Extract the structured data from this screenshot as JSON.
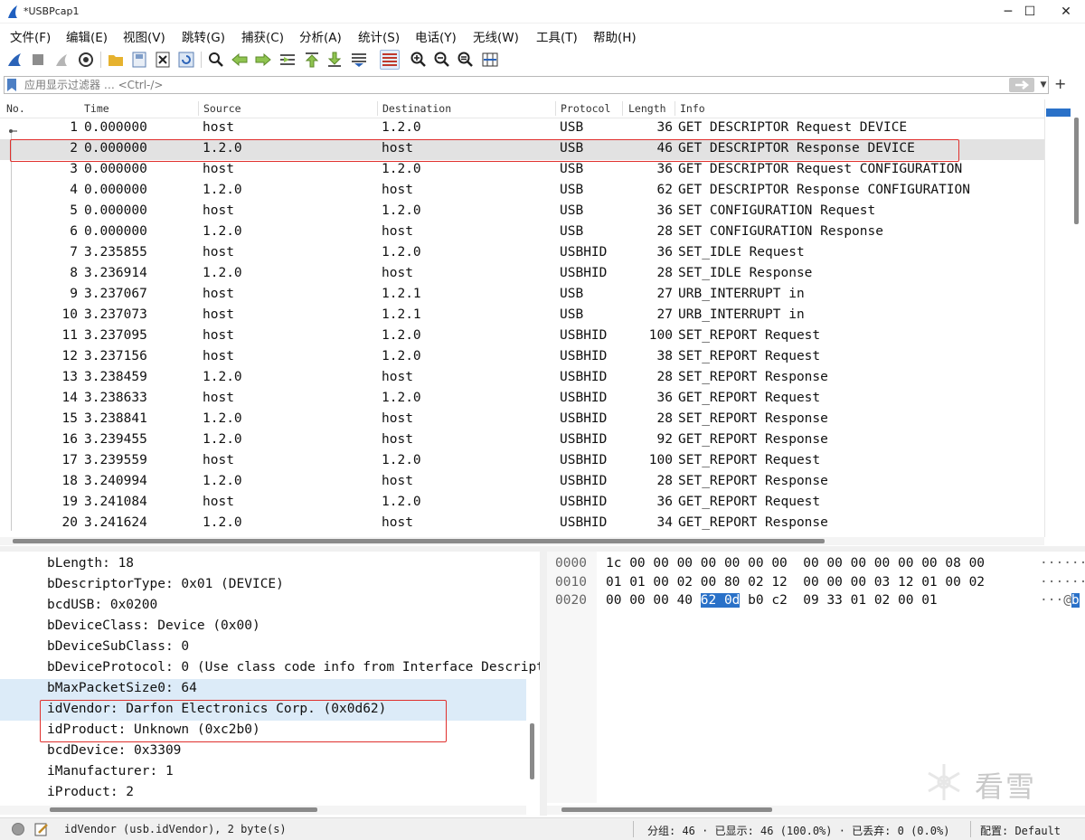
{
  "window": {
    "title": "*USBPcap1",
    "minimize": "─",
    "maximize": "☐",
    "close": "✕"
  },
  "menu": [
    "文件(F)",
    "编辑(E)",
    "视图(V)",
    "跳转(G)",
    "捕获(C)",
    "分析(A)",
    "统计(S)",
    "电话(Y)",
    "无线(W)",
    "工具(T)",
    "帮助(H)"
  ],
  "toolbar": {
    "icons": [
      "shark-fin-start-icon",
      "stop-capture-icon",
      "restart-capture-icon",
      "capture-options-icon",
      "open-folder-icon",
      "save-file-icon",
      "close-file-icon",
      "reload-icon",
      "find-packet-icon",
      "go-back-icon",
      "go-forward-icon",
      "go-to-packet-icon",
      "go-first-icon",
      "go-last-icon",
      "auto-scroll-icon",
      "colorize-icon",
      "zoom-in-icon",
      "zoom-out-icon",
      "zoom-reset-icon",
      "resize-columns-icon"
    ]
  },
  "filter": {
    "placeholder": "应用显示过滤器 … <Ctrl-/>",
    "add": "+"
  },
  "packet_list": {
    "columns": [
      "No.",
      "Time",
      "Source",
      "Destination",
      "Protocol",
      "Length",
      "Info"
    ],
    "selected_index": 1,
    "rows": [
      {
        "no": "1",
        "time": "0.000000",
        "src": "host",
        "dst": "1.2.0",
        "proto": "USB",
        "len": "36",
        "info": "GET DESCRIPTOR Request DEVICE"
      },
      {
        "no": "2",
        "time": "0.000000",
        "src": "1.2.0",
        "dst": "host",
        "proto": "USB",
        "len": "46",
        "info": "GET DESCRIPTOR Response DEVICE"
      },
      {
        "no": "3",
        "time": "0.000000",
        "src": "host",
        "dst": "1.2.0",
        "proto": "USB",
        "len": "36",
        "info": "GET DESCRIPTOR Request CONFIGURATION"
      },
      {
        "no": "4",
        "time": "0.000000",
        "src": "1.2.0",
        "dst": "host",
        "proto": "USB",
        "len": "62",
        "info": "GET DESCRIPTOR Response CONFIGURATION"
      },
      {
        "no": "5",
        "time": "0.000000",
        "src": "host",
        "dst": "1.2.0",
        "proto": "USB",
        "len": "36",
        "info": "SET CONFIGURATION Request"
      },
      {
        "no": "6",
        "time": "0.000000",
        "src": "1.2.0",
        "dst": "host",
        "proto": "USB",
        "len": "28",
        "info": "SET CONFIGURATION Response"
      },
      {
        "no": "7",
        "time": "3.235855",
        "src": "host",
        "dst": "1.2.0",
        "proto": "USBHID",
        "len": "36",
        "info": "SET_IDLE Request"
      },
      {
        "no": "8",
        "time": "3.236914",
        "src": "1.2.0",
        "dst": "host",
        "proto": "USBHID",
        "len": "28",
        "info": "SET_IDLE Response"
      },
      {
        "no": "9",
        "time": "3.237067",
        "src": "host",
        "dst": "1.2.1",
        "proto": "USB",
        "len": "27",
        "info": "URB_INTERRUPT in"
      },
      {
        "no": "10",
        "time": "3.237073",
        "src": "host",
        "dst": "1.2.1",
        "proto": "USB",
        "len": "27",
        "info": "URB_INTERRUPT in"
      },
      {
        "no": "11",
        "time": "3.237095",
        "src": "host",
        "dst": "1.2.0",
        "proto": "USBHID",
        "len": "100",
        "info": "SET_REPORT Request"
      },
      {
        "no": "12",
        "time": "3.237156",
        "src": "host",
        "dst": "1.2.0",
        "proto": "USBHID",
        "len": "38",
        "info": "SET_REPORT Request"
      },
      {
        "no": "13",
        "time": "3.238459",
        "src": "1.2.0",
        "dst": "host",
        "proto": "USBHID",
        "len": "28",
        "info": "SET_REPORT Response"
      },
      {
        "no": "14",
        "time": "3.238633",
        "src": "host",
        "dst": "1.2.0",
        "proto": "USBHID",
        "len": "36",
        "info": "GET_REPORT Request"
      },
      {
        "no": "15",
        "time": "3.238841",
        "src": "1.2.0",
        "dst": "host",
        "proto": "USBHID",
        "len": "28",
        "info": "SET_REPORT Response"
      },
      {
        "no": "16",
        "time": "3.239455",
        "src": "1.2.0",
        "dst": "host",
        "proto": "USBHID",
        "len": "92",
        "info": "GET_REPORT Response"
      },
      {
        "no": "17",
        "time": "3.239559",
        "src": "host",
        "dst": "1.2.0",
        "proto": "USBHID",
        "len": "100",
        "info": "SET_REPORT Request"
      },
      {
        "no": "18",
        "time": "3.240994",
        "src": "1.2.0",
        "dst": "host",
        "proto": "USBHID",
        "len": "28",
        "info": "SET_REPORT Response"
      },
      {
        "no": "19",
        "time": "3.241084",
        "src": "host",
        "dst": "1.2.0",
        "proto": "USBHID",
        "len": "36",
        "info": "GET_REPORT Request"
      },
      {
        "no": "20",
        "time": "3.241624",
        "src": "1.2.0",
        "dst": "host",
        "proto": "USBHID",
        "len": "34",
        "info": "GET_REPORT Response"
      }
    ]
  },
  "details": {
    "lines": [
      "bLength: 18",
      "bDescriptorType: 0x01 (DEVICE)",
      "bcdUSB: 0x0200",
      "bDeviceClass: Device (0x00)",
      "bDeviceSubClass: 0",
      "bDeviceProtocol: 0 (Use class code info from Interface Descriptors)",
      "bMaxPacketSize0: 64",
      "idVendor: Darfon Electronics Corp. (0x0d62)",
      "idProduct: Unknown (0xc2b0)",
      "bcdDevice: 0x3309",
      "iManufacturer: 1",
      "iProduct: 2"
    ],
    "highlighted_lines": [
      6,
      7
    ]
  },
  "bytes": {
    "rows": [
      {
        "offset": "0000",
        "pre": "1c 00 00 00 00 00 00 00  00 00 00 00 00 00 08 00",
        "sel": "",
        "post": "",
        "ascii_pre": "·······",
        "ascii_sel": ""
      },
      {
        "offset": "0010",
        "pre": "01 01 00 02 00 80 02 12  00 00 00 03 12 01 00 02",
        "sel": "",
        "post": "",
        "ascii_pre": "·······",
        "ascii_sel": ""
      },
      {
        "offset": "0020",
        "pre": "00 00 00 40 ",
        "sel": "62 0d",
        "post": " b0 c2  09 33 01 02 00 01",
        "ascii_pre": "···@",
        "ascii_sel": "b"
      }
    ]
  },
  "watermark": "看雪",
  "status": {
    "field": "idVendor (usb.idVendor), 2 byte(s)",
    "counts": "分组: 46 · 已显示: 46 (100.0%) · 已丢弃: 0 (0.0%)",
    "profile": "配置: Default"
  },
  "colors": {
    "selection_blue": "#2a71c8",
    "annotation_red": "#e0302d",
    "row_selected": "#e2e2e2",
    "detail_highlight": "#dcebf8"
  }
}
